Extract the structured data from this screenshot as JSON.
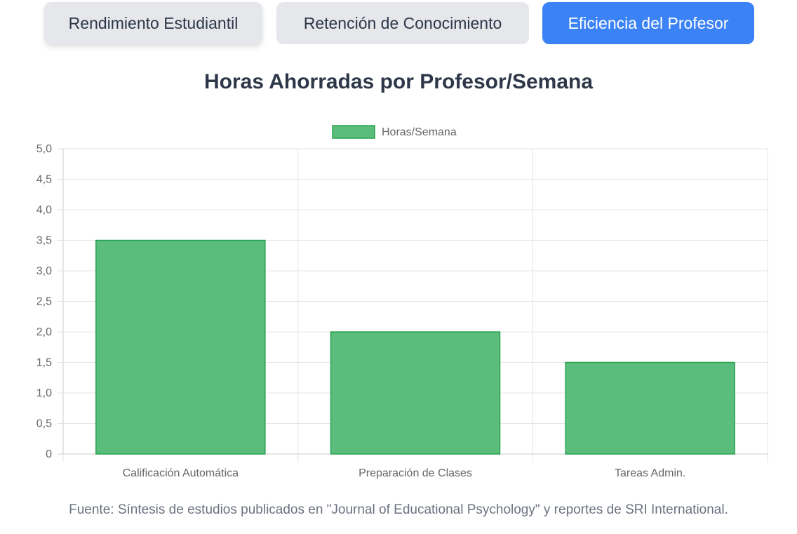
{
  "tabs": [
    {
      "label": "Rendimiento Estudiantil",
      "active": false
    },
    {
      "label": "Retención de Conocimiento",
      "active": false
    },
    {
      "label": "Eficiencia del Profesor",
      "active": true
    }
  ],
  "colors": {
    "accent": "#3b82f6",
    "bar_fill": "#5bbd7b",
    "bar_stroke": "#27a04f"
  },
  "chart_data": {
    "type": "bar",
    "title": "Horas Ahorradas por Profesor/Semana",
    "categories": [
      "Calificación Automática",
      "Preparación de Clases",
      "Tareas Admin."
    ],
    "series": [
      {
        "name": "Horas/Semana",
        "values": [
          3.5,
          2.0,
          1.5
        ]
      }
    ],
    "y_ticks": [
      "0",
      "0,5",
      "1,0",
      "1,5",
      "2,0",
      "2,5",
      "3,0",
      "3,5",
      "4,0",
      "4,5",
      "5,0"
    ],
    "ylim": [
      0,
      5
    ],
    "grid": true,
    "legend_position": "top-center"
  },
  "source_note": "Fuente: Síntesis de estudios publicados en \"Journal of Educational Psychology\" y reportes de SRI International."
}
